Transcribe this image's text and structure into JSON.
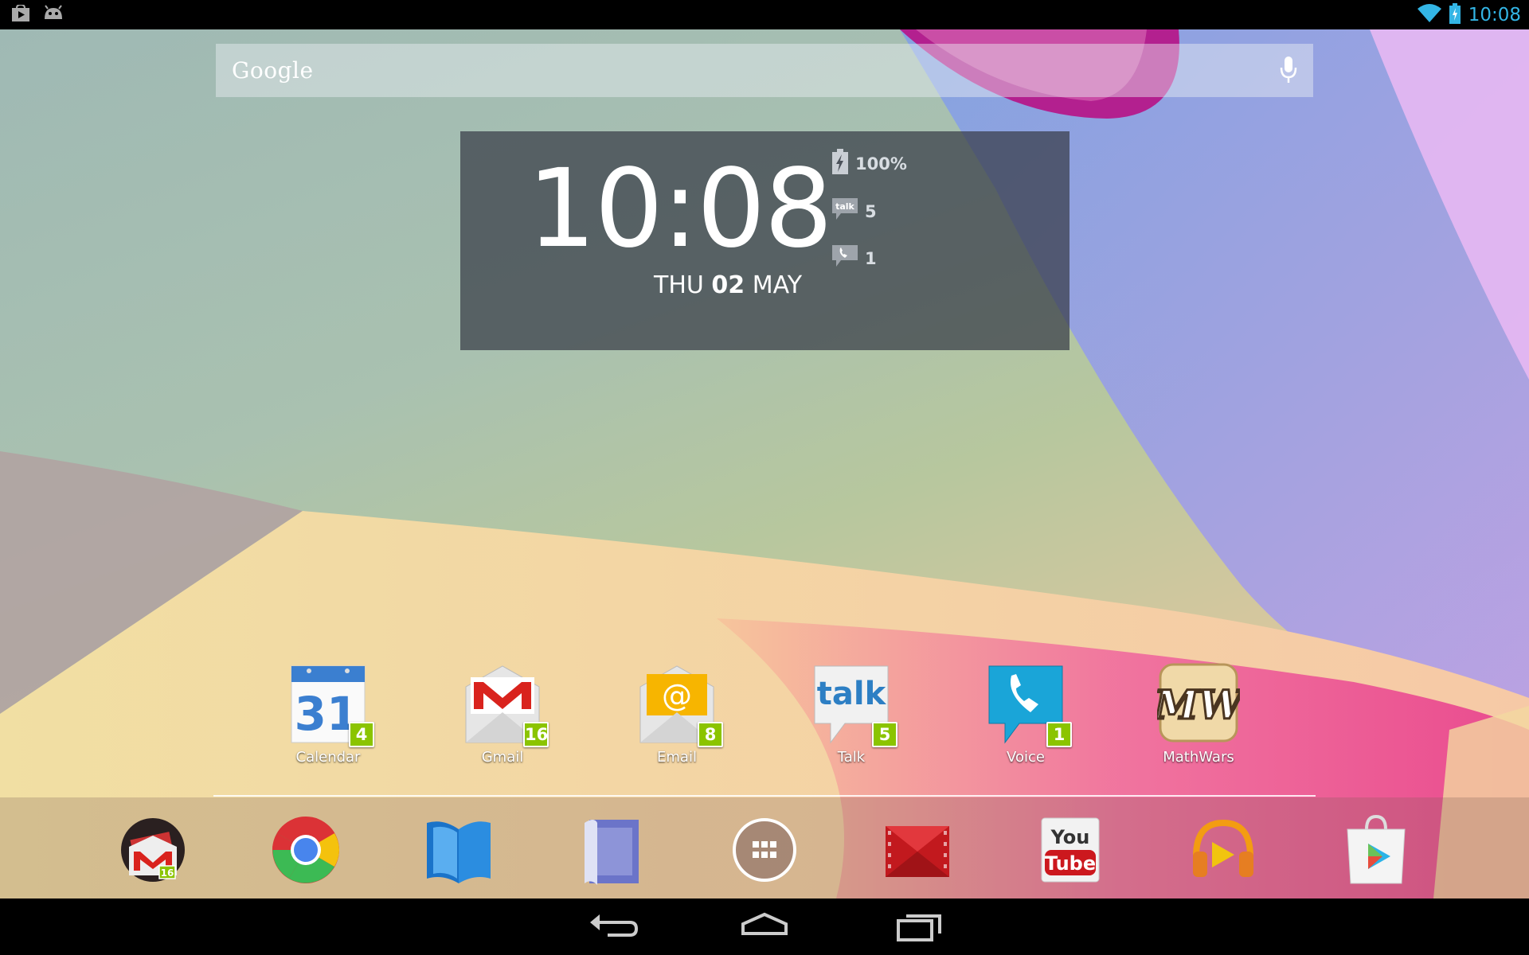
{
  "status_bar": {
    "time": "10:08",
    "left_icons": [
      "play-store-notification-icon",
      "android-debug-icon"
    ],
    "right_icons": [
      "wifi-icon",
      "battery-charging-icon"
    ],
    "accent": "#33b5e5"
  },
  "search": {
    "logo": "Google",
    "mic_icon": "mic-icon"
  },
  "clock_widget": {
    "time": "10:08",
    "day": "THU",
    "date": "02",
    "month": "MAY",
    "battery": "100%",
    "talk_count": "5",
    "voice_count": "1"
  },
  "apps": [
    {
      "label": "Calendar",
      "badge": "4",
      "icon": "calendar-icon",
      "icon_text": "31"
    },
    {
      "label": "Gmail",
      "badge": "16",
      "icon": "gmail-icon",
      "icon_text": ""
    },
    {
      "label": "Email",
      "badge": "8",
      "icon": "email-icon",
      "icon_text": "@"
    },
    {
      "label": "Talk",
      "badge": "5",
      "icon": "talk-icon",
      "icon_text": "talk"
    },
    {
      "label": "Voice",
      "badge": "1",
      "icon": "voice-icon",
      "icon_text": ""
    },
    {
      "label": "MathWars",
      "badge": "",
      "icon": "mathwars-icon",
      "icon_text": "MW"
    }
  ],
  "dock": {
    "gmail_badge": "16",
    "youtube_top": "You",
    "youtube_bottom": "Tube",
    "items": [
      "gmail-folder-icon",
      "chrome-icon",
      "play-books-icon",
      "magazines-icon",
      "all-apps-icon",
      "play-movies-icon",
      "youtube-icon",
      "play-music-icon",
      "play-store-icon"
    ]
  },
  "nav": {
    "buttons": [
      "back-icon",
      "home-icon",
      "recent-apps-icon"
    ]
  },
  "colors": {
    "badge": "#8bc400",
    "widget_bg": "#3a404a"
  }
}
